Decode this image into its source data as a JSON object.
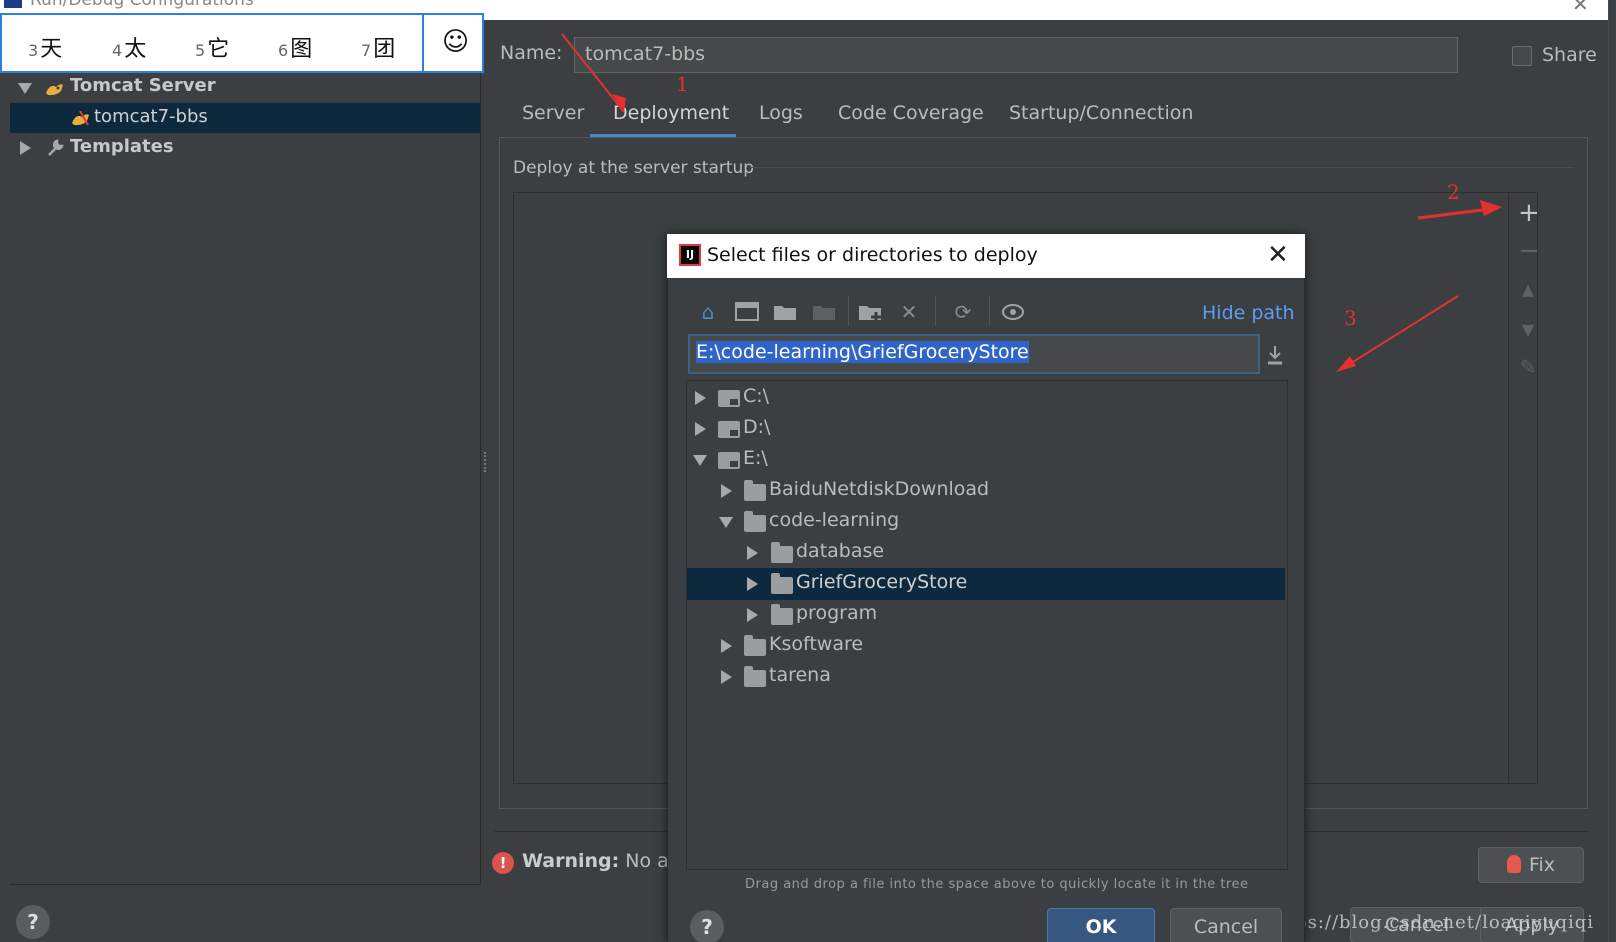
{
  "window": {
    "title": "Run/Debug Configurations"
  },
  "ime": {
    "candidates": [
      {
        "num": "3",
        "char": "天"
      },
      {
        "num": "4",
        "char": "太"
      },
      {
        "num": "5",
        "char": "它"
      },
      {
        "num": "6",
        "char": "图"
      },
      {
        "num": "7",
        "char": "团"
      }
    ],
    "emoji": "☺"
  },
  "tree": {
    "tomcat_server": "Tomcat Server",
    "config_item": "tomcat7-bbs",
    "templates": "Templates"
  },
  "form": {
    "name_label": "Name:",
    "name_value": "tomcat7-bbs",
    "share_label": "Share",
    "tabs": [
      "Server",
      "Deployment",
      "Logs",
      "Code Coverage",
      "Startup/Connection"
    ],
    "deploy_title": "Deploy at the server startup",
    "warning_bold": "Warning:",
    "warning_text": "No art",
    "fix_label": "Fix",
    "cancel_label": "Cancel",
    "apply_label": "Apply"
  },
  "dialog": {
    "title": "Select files or directories to deploy",
    "hide_path": "Hide path",
    "path_value": "E:\\code-learning\\GriefGroceryStore",
    "tree": [
      {
        "label": "C:\\",
        "kind": "drive",
        "depth": 0,
        "state": "collapsed"
      },
      {
        "label": "D:\\",
        "kind": "drive",
        "depth": 0,
        "state": "collapsed"
      },
      {
        "label": "E:\\",
        "kind": "drive",
        "depth": 0,
        "state": "expanded"
      },
      {
        "label": "BaiduNetdiskDownload",
        "kind": "folder",
        "depth": 1,
        "state": "collapsed"
      },
      {
        "label": "code-learning",
        "kind": "folder",
        "depth": 1,
        "state": "expanded"
      },
      {
        "label": "database",
        "kind": "folder",
        "depth": 2,
        "state": "collapsed"
      },
      {
        "label": "GriefGroceryStore",
        "kind": "folder",
        "depth": 2,
        "state": "collapsed",
        "selected": true
      },
      {
        "label": "program",
        "kind": "folder",
        "depth": 2,
        "state": "collapsed"
      },
      {
        "label": "Ksoftware",
        "kind": "folder",
        "depth": 1,
        "state": "collapsed"
      },
      {
        "label": "tarena",
        "kind": "folder",
        "depth": 1,
        "state": "collapsed"
      }
    ],
    "hint": "Drag and drop a file into the space above to quickly locate it in the tree",
    "ok_label": "OK",
    "cancel_label": "Cancel",
    "help": "?"
  },
  "annotations": [
    "1",
    "2",
    "3"
  ],
  "watermark": "https://blog.csdn.net/loaqiyuqiqi",
  "colors": {
    "accent": "#4a88c7",
    "selection": "#0d293e",
    "link": "#589df6",
    "annotation": "#e53030",
    "ok": "#365880"
  }
}
